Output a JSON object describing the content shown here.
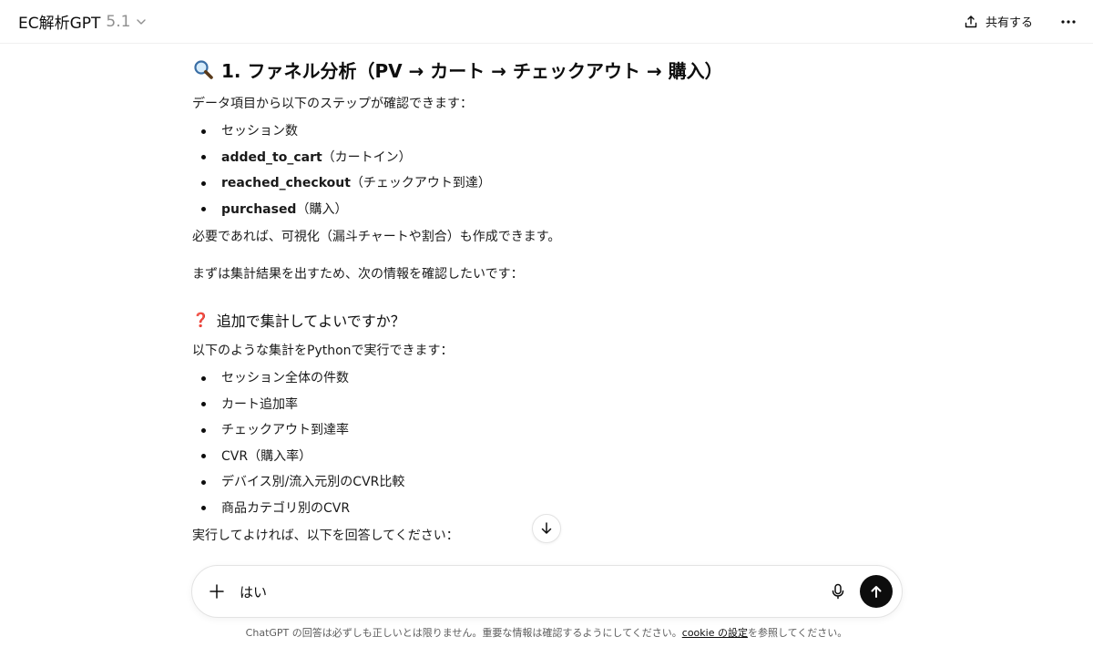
{
  "header": {
    "app_title": "EC解析GPT",
    "model_version": "5.1",
    "share_label": "共有する"
  },
  "content": {
    "heading1": "1. ファネル分析（PV → カート → チェックアウト → 購入）",
    "intro": "データ項目から以下のステップが確認できます：",
    "steps": [
      {
        "strong": "",
        "text": "セッション数"
      },
      {
        "strong": "added_to_cart",
        "text": "（カートイン）"
      },
      {
        "strong": "reached_checkout",
        "text": "（チェックアウト到達）"
      },
      {
        "strong": "purchased",
        "text": "（購入）"
      }
    ],
    "after_steps": "必要であれば、可視化（漏斗チャートや割合）も作成できます。",
    "next_para": "まずは集計結果を出すため、次の情報を確認したいです：",
    "heading2_icon": "❓",
    "heading2": "追加で集計してよいですか？",
    "py_intro": "以下のような集計をPythonで実行できます：",
    "aggregations": [
      "セッション全体の件数",
      "カート追加率",
      "チェックアウト到達率",
      "CVR（購入率）",
      "デバイス別/流入元別のCVR比較",
      "商品カテゴリ別のCVR"
    ],
    "last_para": "実行してよければ、以下を回答してください："
  },
  "composer": {
    "input_value": "はい"
  },
  "footer": {
    "disclaimer_pre": "ChatGPT の回答は必ずしも正しいとは限りません。重要な情報は確認するようにしてください。",
    "disclaimer_link": "cookie の設定",
    "disclaimer_post": "を参照してください。"
  }
}
